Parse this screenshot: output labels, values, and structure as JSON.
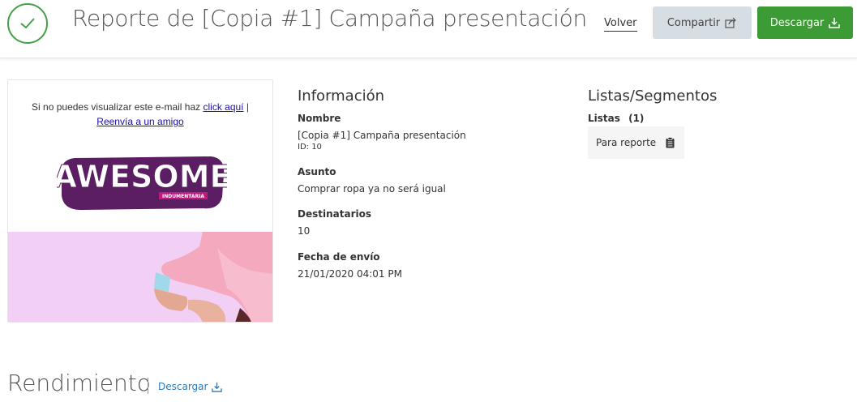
{
  "header": {
    "title": "Reporte de [Copia #1] Campaña presentación",
    "back_label": "Volver",
    "share_label": "Compartir",
    "download_label": "Descargar"
  },
  "preview": {
    "intro_text": "Si no puedes visualizar este e-mail haz ",
    "click_link": "click aquí",
    "separator": " |",
    "forward_link": "Reenvía a un amigo",
    "logo_text": "AWESOME",
    "logo_subtext": "INDUMENTARIA"
  },
  "info": {
    "title": "Información",
    "name_label": "Nombre",
    "name_value": "[Copia #1] Campaña presentación",
    "id_value": "ID: 10",
    "subject_label": "Asunto",
    "subject_value": "Comprar ropa ya no será igual",
    "recipients_label": "Destinatarios",
    "recipients_value": "10",
    "date_label": "Fecha de envío",
    "date_value": "21/01/2020 04:01 PM"
  },
  "lists": {
    "title": "Listas/Segmentos",
    "lists_label": "Listas",
    "lists_count": "(1)",
    "items": [
      {
        "label": "Para reporte"
      }
    ]
  },
  "performance": {
    "title": "Rendimiento",
    "download_label": "Descargar"
  },
  "colors": {
    "accent_green": "#3d9b35",
    "check_green": "#43a047",
    "share_bg": "#d6dde3",
    "link_blue": "#2a7ab8",
    "logo_purple": "#5b1e63",
    "logo_magenta": "#c2187b"
  },
  "icons": {
    "status": "check-circle-icon",
    "share": "share-icon",
    "download": "download-icon",
    "clipboard": "clipboard-icon"
  }
}
